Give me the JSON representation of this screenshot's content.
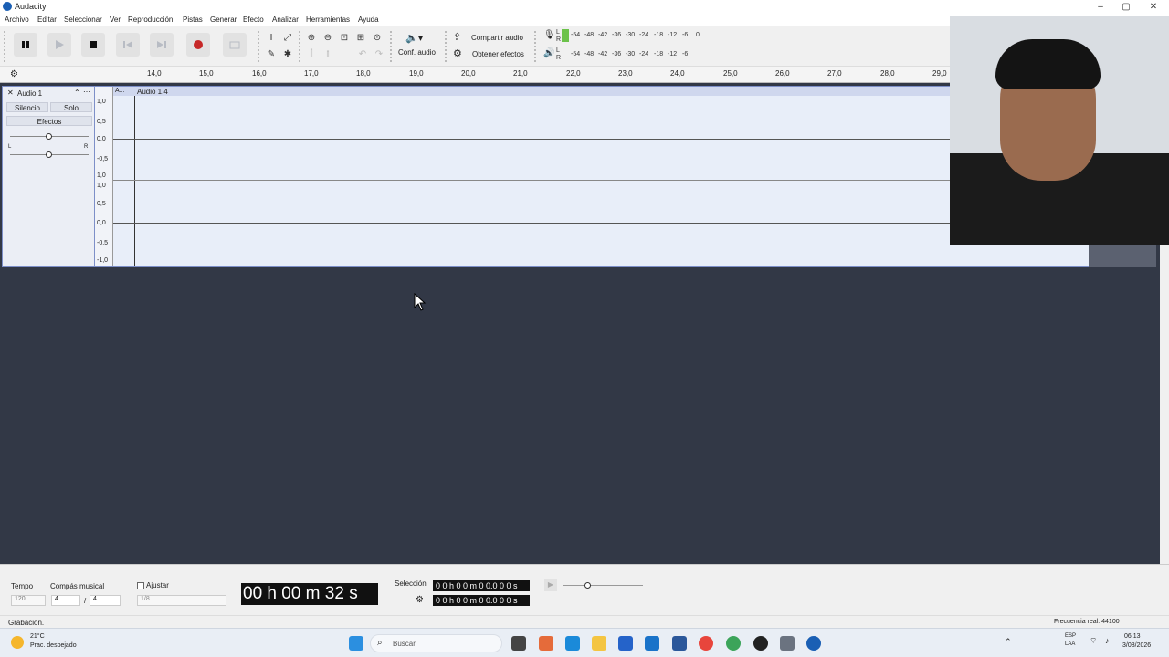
{
  "window": {
    "title": "Audacity"
  },
  "menu": [
    "Archivo",
    "Editar",
    "Seleccionar",
    "Ver",
    "Reproducción",
    "Pistas",
    "Generar",
    "Efecto",
    "Analizar",
    "Herramientas",
    "Ayuda"
  ],
  "toolbar": {
    "audio_setup_label": "Conf. audio",
    "share_audio_label": "Compartir audio",
    "get_effects_label": "Obtener efectos",
    "record_meter_ticks": [
      "-54",
      "-48",
      "-42",
      "-36",
      "-30",
      "-24",
      "-18",
      "-12",
      "-6",
      "0"
    ],
    "play_meter_ticks": [
      "-54",
      "-48",
      "-42",
      "-36",
      "-30",
      "-24",
      "-18",
      "-12",
      "-6"
    ],
    "meter_lr": {
      "l": "L",
      "r": "R"
    }
  },
  "ruler": {
    "ticks": [
      "14,0",
      "15,0",
      "16,0",
      "17,0",
      "18,0",
      "19,0",
      "20,0",
      "21,0",
      "22,0",
      "23,0",
      "24,0",
      "25,0",
      "26,0",
      "27,0",
      "28,0",
      "29,0"
    ]
  },
  "track": {
    "name": "Audio 1",
    "mute_label": "Silencio",
    "solo_label": "Solo",
    "effects_label": "Efectos",
    "pan_l": "L",
    "pan_r": "R",
    "clip_header_short": "A...",
    "clip_name": "Audio 1.4",
    "scale_top": [
      "1,0",
      "0,5",
      "0,0",
      "-0,5",
      "1,0"
    ],
    "scale_bottom": [
      "1,0",
      "0,5",
      "0,0",
      "-0,5",
      "-1,0"
    ]
  },
  "bottom": {
    "tempo_label": "Tempo",
    "tempo_value": "120",
    "time_sig_label": "Compás musical",
    "time_sig_num": "4",
    "time_sig_den": "4",
    "snap_label": "Ajustar",
    "snap_value": "1/8",
    "time_display": "00 h 00 m 32 s",
    "selection_label": "Selección",
    "sel_start": "0 0 h 0 0 m 0 0.0 0 0 s",
    "sel_end": "0 0 h 0 0 m 0 0.0 0 0 s"
  },
  "status": {
    "left": "Grabación.",
    "right": "Frecuencia real: 44100"
  },
  "taskbar": {
    "weather_temp": "21°C",
    "weather_desc": "Prac. despejado",
    "search_placeholder": "Buscar",
    "lang_1": "ESP",
    "lang_2": "LAA",
    "time": "06:13",
    "date": "3/08/2026"
  },
  "colors": {
    "record_red": "#c62828",
    "track_bg": "#323846",
    "wave_bg": "#e8eef9",
    "meter_green": "#6cc24a"
  }
}
